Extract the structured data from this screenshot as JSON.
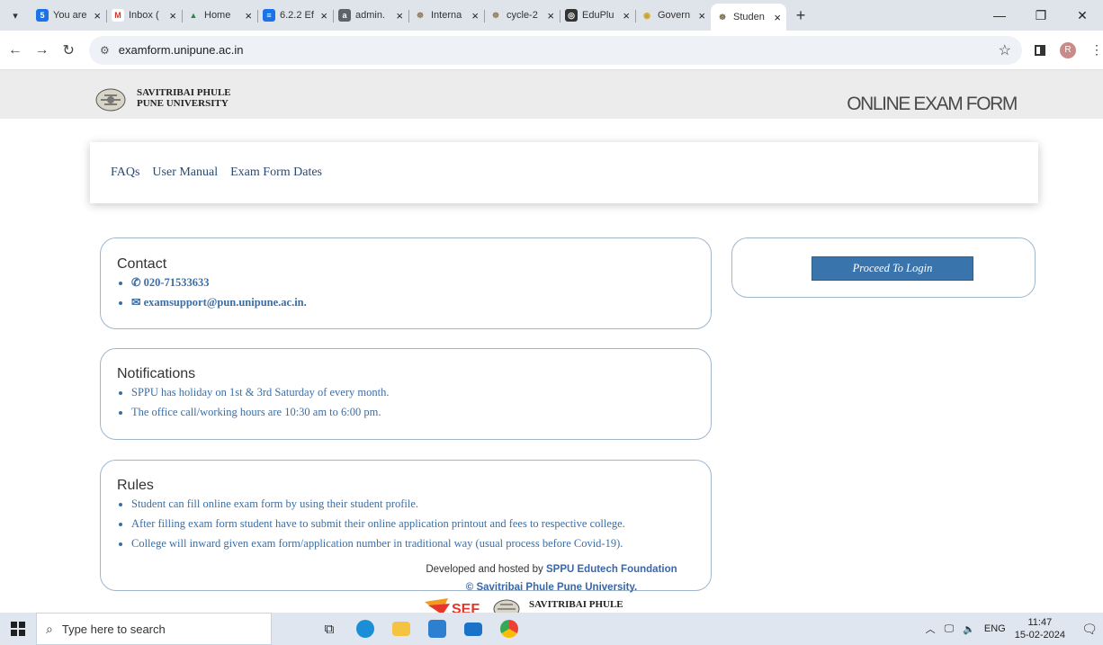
{
  "browser": {
    "tabs": [
      {
        "title": "You are",
        "fav_letter": "5",
        "fav_color": "#1a73e8"
      },
      {
        "title": "Inbox (",
        "fav_letter": "M",
        "fav_color": "#d93025"
      },
      {
        "title": "Home",
        "fav_letter": "▲",
        "fav_color": "#1e8e3e"
      },
      {
        "title": "6.2.2 Ef",
        "fav_letter": "≡",
        "fav_color": "#1a73e8"
      },
      {
        "title": "admin.",
        "fav_letter": "a",
        "fav_color": "#5f6368"
      },
      {
        "title": "Interna",
        "fav_letter": "☸",
        "fav_color": "#8c7a5b"
      },
      {
        "title": "cycle-2",
        "fav_letter": "☸",
        "fav_color": "#8c7a5b"
      },
      {
        "title": "EduPlu",
        "fav_letter": "◎",
        "fav_color": "#333333"
      },
      {
        "title": "Govern",
        "fav_letter": "◉",
        "fav_color": "#c9a227"
      },
      {
        "title": "Studen",
        "fav_letter": "☸",
        "fav_color": "#7a6a4a",
        "active": true
      }
    ],
    "new_tab": "+",
    "url": "examform.unipune.ac.in",
    "profile_initial": "R"
  },
  "header": {
    "univ_line1": "SAVITRIBAI PHULE",
    "univ_line2": "PUNE UNIVERSITY",
    "title": "ONLINE EXAM FORM"
  },
  "nav": {
    "faqs": "FAQs",
    "user_manual": "User Manual",
    "exam_dates": "Exam Form Dates"
  },
  "contact": {
    "heading": "Contact",
    "phone": "020-71533633",
    "email": "examsupport@pun.unipune.ac.in."
  },
  "notifications": {
    "heading": "Notifications",
    "items": [
      "SPPU has holiday on 1st & 3rd Saturday of every month.",
      "The office call/working hours are 10:30 am to 6:00 pm."
    ]
  },
  "rules": {
    "heading": "Rules",
    "items": [
      "Student can fill online exam form by using their student profile.",
      "After filling exam form student have to submit their online application printout and fees to respective college.",
      "College will inward given exam form/application number in traditional way (usual process before Covid-19)."
    ]
  },
  "login": {
    "button": "Proceed To Login"
  },
  "footer": {
    "developed_by": "Developed and hosted by",
    "org": "SPPU Edutech Foundation",
    "copyright": "© Savitribai Phule Pune University.",
    "univ": "SAVITRIBAI PHULE"
  },
  "taskbar": {
    "search_placeholder": "Type here to search",
    "lang": "ENG",
    "time": "11:47",
    "date": "15-02-2024"
  }
}
